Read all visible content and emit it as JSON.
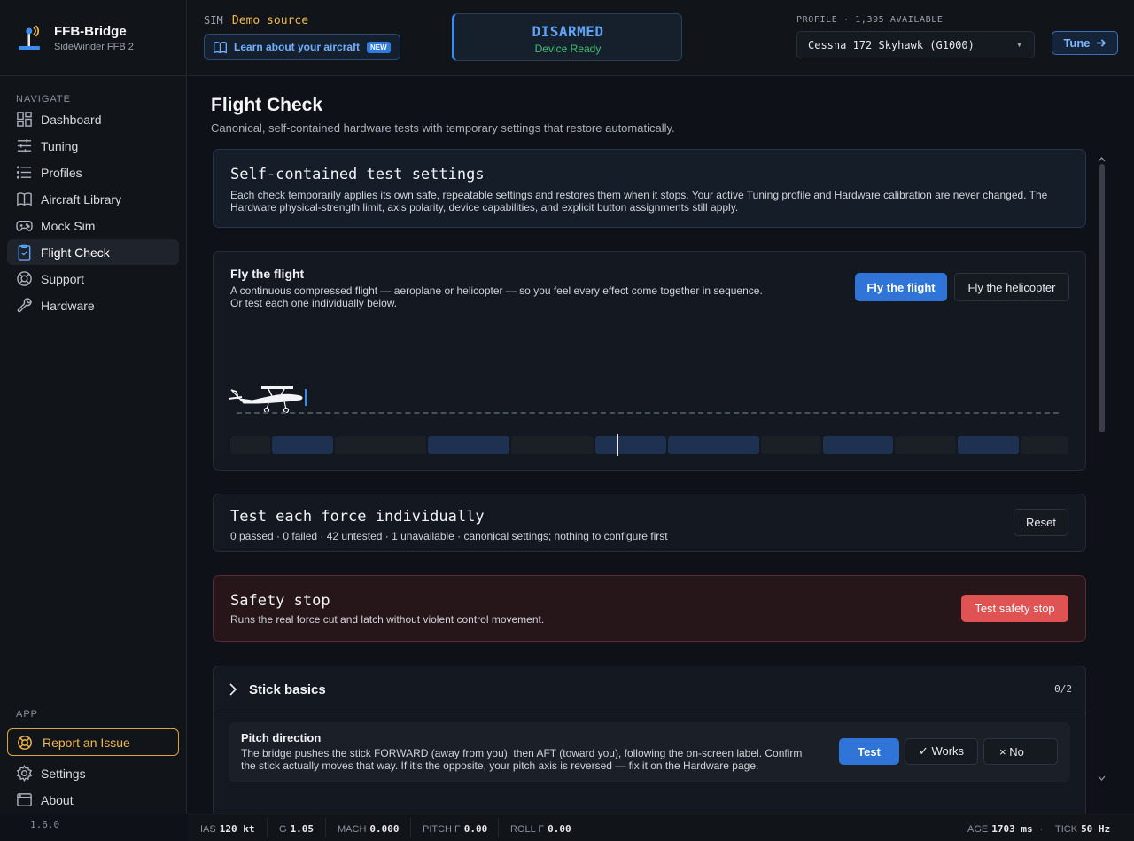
{
  "app": {
    "name": "FFB-Bridge",
    "device": "SideWinder FFB 2",
    "version": "1.6.0"
  },
  "nav": {
    "heading": "NAVIGATE",
    "items": [
      {
        "label": "Dashboard",
        "icon": "dashboard-icon"
      },
      {
        "label": "Tuning",
        "icon": "sliders-icon"
      },
      {
        "label": "Profiles",
        "icon": "list-icon"
      },
      {
        "label": "Aircraft Library",
        "icon": "book-icon"
      },
      {
        "label": "Mock Sim",
        "icon": "gamepad-icon"
      },
      {
        "label": "Flight Check",
        "icon": "clipboard-check-icon",
        "active": true
      },
      {
        "label": "Support",
        "icon": "lifebuoy-icon"
      },
      {
        "label": "Hardware",
        "icon": "wrench-icon"
      }
    ],
    "app_heading": "APP",
    "report_issue": "Report an Issue",
    "settings": "Settings",
    "about": "About"
  },
  "topbar": {
    "sim_label": "SIM",
    "sim_value": "Demo source",
    "learn_label": "Learn about your aircraft",
    "new_badge": "NEW",
    "status_title": "DISARMED",
    "status_sub": "Device Ready",
    "profile_label": "PROFILE · 1,395 AVAILABLE",
    "profile_value": "Cessna 172 Skyhawk (G1000)",
    "tune_label": "Tune"
  },
  "page": {
    "title": "Flight Check",
    "subtitle": "Canonical, self-contained hardware tests with temporary settings that restore automatically."
  },
  "settings_card": {
    "title": "Self-contained test settings",
    "description": "Each check temporarily applies its own safe, repeatable settings and restores them when it stops. Your active Tuning profile and Hardware calibration are never changed. The Hardware physical-strength limit, axis polarity, device capabilities, and explicit button assignments still apply."
  },
  "fly_card": {
    "title": "Fly the flight",
    "description_line1": "A continuous compressed flight — aeroplane or helicopter — so you feel every effect come together in sequence.",
    "description_line2": "Or test each one individually below.",
    "primary_button": "Fly the flight",
    "secondary_button": "Fly the helicopter",
    "playhead_progress": 0.461,
    "timeline_segments": [
      {
        "start": 0.0,
        "end": 0.048,
        "highlighted": false
      },
      {
        "start": 0.05,
        "end": 0.123,
        "highlighted": true
      },
      {
        "start": 0.125,
        "end": 0.234,
        "highlighted": false
      },
      {
        "start": 0.236,
        "end": 0.333,
        "highlighted": true
      },
      {
        "start": 0.335,
        "end": 0.433,
        "highlighted": false
      },
      {
        "start": 0.435,
        "end": 0.52,
        "highlighted": true
      },
      {
        "start": 0.522,
        "end": 0.631,
        "highlighted": true
      },
      {
        "start": 0.633,
        "end": 0.705,
        "highlighted": false
      },
      {
        "start": 0.707,
        "end": 0.791,
        "highlighted": true
      },
      {
        "start": 0.793,
        "end": 0.866,
        "highlighted": false
      },
      {
        "start": 0.868,
        "end": 0.941,
        "highlighted": true
      },
      {
        "start": 0.943,
        "end": 1.0,
        "highlighted": false
      }
    ]
  },
  "force_card": {
    "title": "Test each force individually",
    "summary": "0 passed · 0 failed · 42 untested · 1 unavailable · canonical settings; nothing to configure first",
    "reset_button": "Reset"
  },
  "safety_card": {
    "title": "Safety stop",
    "description": "Runs the real force cut and latch without violent control movement.",
    "button": "Test safety stop"
  },
  "stick_basics": {
    "title": "Stick basics",
    "count": "0/2",
    "check": {
      "title": "Pitch direction",
      "description_line1": "The bridge pushes the stick FORWARD (away from you), then AFT (toward you), following the on-screen label. Confirm",
      "description_line2": "the stick actually moves that way. If it's the opposite, your pitch axis is reversed — fix it on the Hardware page.",
      "test_button": "Test",
      "works_button": "✓ Works",
      "no_button": "× No"
    }
  },
  "statusbar": {
    "ias_label": "IAS",
    "ias_value": "120 kt",
    "g_label": "G",
    "g_value": "1.05",
    "mach_label": "MACH",
    "mach_value": "0.000",
    "pitchf_label": "PITCH F",
    "pitchf_value": "0.00",
    "rollf_label": "ROLL F",
    "rollf_value": "0.00",
    "age_label": "AGE",
    "age_value": "1703 ms",
    "tick_label": "TICK",
    "tick_value": "50 Hz"
  },
  "colors": {
    "accent": "#2f74d6",
    "warning": "#f0b84a",
    "success": "#3fbf74",
    "danger": "#e05353"
  }
}
